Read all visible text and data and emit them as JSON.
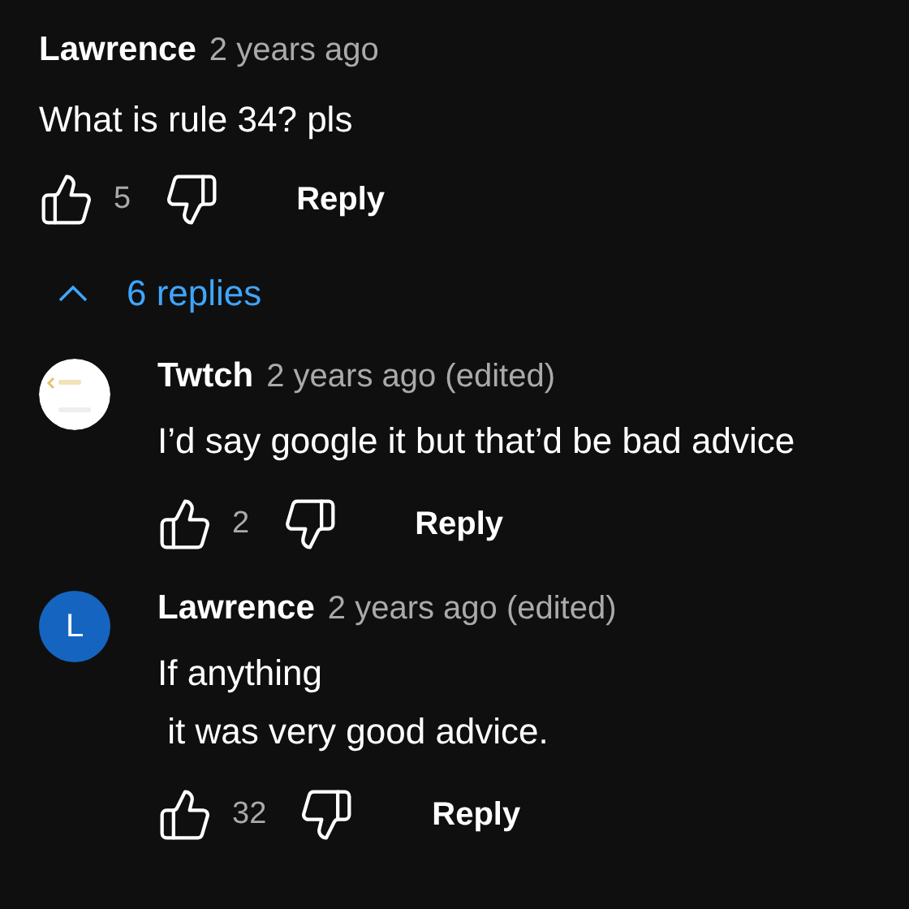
{
  "comment": {
    "author": "Lawrence",
    "time": "2 years ago",
    "body": "What is rule 34? pls",
    "likes": "5",
    "reply_label": "Reply"
  },
  "replies_toggle": {
    "label": "6 replies",
    "expanded": true
  },
  "replies": [
    {
      "author": "Twtch",
      "time": "2 years ago (edited)",
      "body": "I’d say google it but that’d be bad advice",
      "likes": "2",
      "reply_label": "Reply"
    },
    {
      "author": "Lawrence",
      "time": "2 years ago (edited)",
      "body": "If anything\n it was very good advice.",
      "likes": "32",
      "reply_label": "Reply",
      "avatar": {
        "kind": "letter",
        "letter": "L",
        "color": "#1565c0"
      }
    }
  ]
}
